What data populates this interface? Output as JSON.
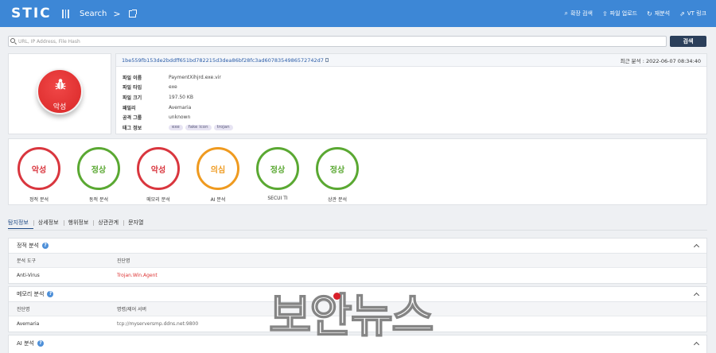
{
  "topbar": {
    "logo": "STIC",
    "nav_label": "Search",
    "nav_chevron": ">",
    "actions": [
      {
        "label": "확장 검색",
        "icon": "search-icon"
      },
      {
        "label": "파일 업로드",
        "icon": "upload-icon"
      },
      {
        "label": "재분석",
        "icon": "refresh-icon"
      },
      {
        "label": "VT 링크",
        "icon": "external-link-icon"
      }
    ]
  },
  "search": {
    "placeholder": "URL, IP Address, File Hash",
    "button_label": "검색"
  },
  "file": {
    "verdict_badge": "악성",
    "hash": "1be559fb153de2bddff651bd782215d3dea86bf28fc3ad6078354986572742d7",
    "last_analysis": "최근 분석 : 2022-06-07 08:34:40",
    "info": [
      {
        "key": "파일 이름",
        "value": "PaymentXihjrd.exe.vir"
      },
      {
        "key": "파일 타입",
        "value": "exe"
      },
      {
        "key": "파일 크기",
        "value": "197.50 KB"
      },
      {
        "key": "패밀리",
        "value": "Avemaria"
      },
      {
        "key": "공격 그룹",
        "value": "unknown"
      },
      {
        "key": "태그 정보",
        "tags": [
          "exe",
          "fake icon",
          "trojan"
        ]
      }
    ]
  },
  "verdicts": [
    {
      "result": "악성",
      "label": "정적 분석",
      "color": "#d9363e"
    },
    {
      "result": "정상",
      "label": "동적 분석",
      "color": "#5aa832"
    },
    {
      "result": "악성",
      "label": "메모리 분석",
      "color": "#d9363e"
    },
    {
      "result": "의심",
      "label": "AI 분석",
      "color": "#ef9a1f"
    },
    {
      "result": "정상",
      "label": "SECUI TI",
      "color": "#5aa832"
    },
    {
      "result": "정상",
      "label": "상관 분석",
      "color": "#5aa832"
    }
  ],
  "tabs": [
    "탐지정보",
    "상세정보",
    "행위정보",
    "상관관계",
    "문자열"
  ],
  "sections": {
    "static": {
      "title": "정적 분석",
      "headers": [
        "분석 도구",
        "진단명"
      ],
      "row": [
        "Anti-Virus",
        "Trojan.Win.Agent"
      ]
    },
    "memory": {
      "title": "메모리 분석",
      "headers": [
        "진단명",
        "명령/제어 서버"
      ],
      "row": [
        "Avemaria",
        "tcp://myserversmp.ddns.net:9800"
      ]
    },
    "ai": {
      "title": "AI 분석"
    }
  },
  "watermark": "보안뉴스"
}
